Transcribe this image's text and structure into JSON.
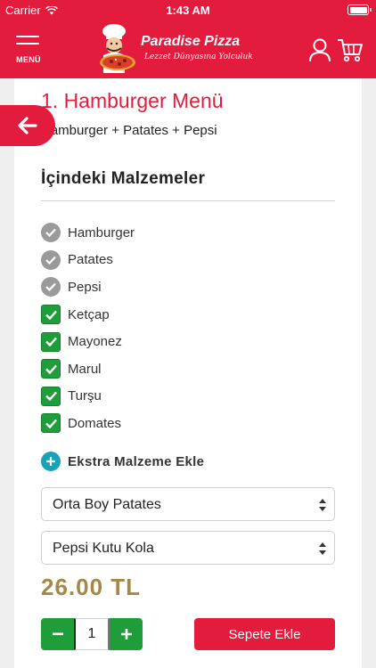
{
  "status_bar": {
    "carrier": "Carrier",
    "time": "1:43 AM"
  },
  "header": {
    "menu_label": "MENÜ",
    "brand_name": "Paradise Pizza",
    "slogan": "Lezzet Dünyasına Yolculuk",
    "accent_color": "#e31b3c"
  },
  "product": {
    "title": "1. Hamburger Menü",
    "description": "Hamburger + Patates + Pepsi",
    "price": "26.00 TL"
  },
  "ingredients_section": {
    "title": "İçindeki Malzemeler",
    "items": [
      {
        "name": "Hamburger",
        "state": "fixed"
      },
      {
        "name": "Patates",
        "state": "fixed"
      },
      {
        "name": "Pepsi",
        "state": "fixed"
      },
      {
        "name": "Ketçap",
        "state": "checked"
      },
      {
        "name": "Mayonez",
        "state": "checked"
      },
      {
        "name": "Marul",
        "state": "checked"
      },
      {
        "name": "Turşu",
        "state": "checked"
      },
      {
        "name": "Domates",
        "state": "checked"
      }
    ]
  },
  "extras": {
    "label": "Ekstra Malzeme Ekle"
  },
  "options": {
    "fries_selected": "Orta Boy Patates",
    "drink_selected": "Pepsi Kutu Kola"
  },
  "quantity": {
    "value": "1",
    "minus_symbol": "−",
    "plus_symbol": "+"
  },
  "add_to_cart_label": "Sepete Ekle",
  "icons": {
    "menu": "hamburger-menu-icon",
    "user": "user-icon",
    "cart": "cart-icon",
    "back": "arrow-left-icon",
    "fixed_item": "check-circle-icon",
    "checked_item": "checkbox-checked-icon",
    "add_extra": "plus-circle-icon",
    "select": "select-arrows-icon"
  }
}
